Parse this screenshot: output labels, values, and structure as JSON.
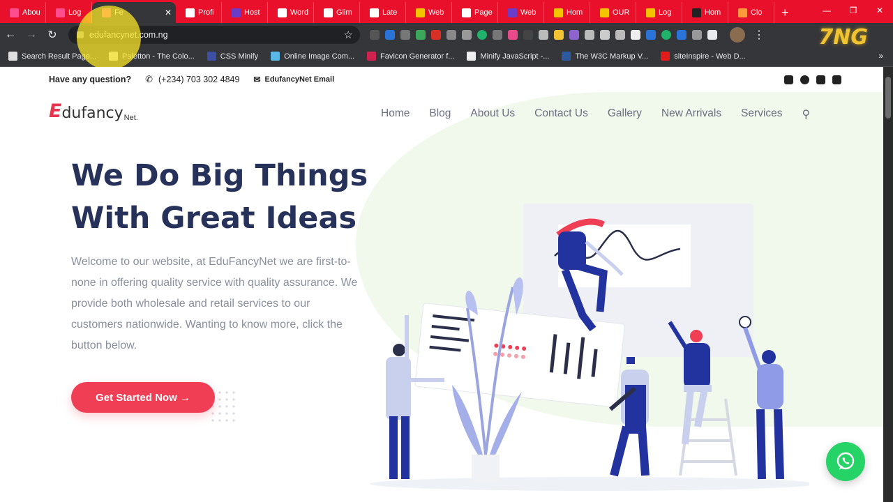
{
  "browser": {
    "tabs": [
      {
        "label": "Abou",
        "color": "#ff4d8d"
      },
      {
        "label": "Log",
        "color": "#ff4d8d"
      },
      {
        "label": "Fe",
        "color": "#ff4d8d",
        "active": true
      },
      {
        "label": "Profi",
        "color": "#ffffff"
      },
      {
        "label": "Host",
        "color": "#6a3cc8"
      },
      {
        "label": "Word",
        "color": "#ffffff"
      },
      {
        "label": "Glim",
        "color": "#ffffff"
      },
      {
        "label": "Late",
        "color": "#ffffff"
      },
      {
        "label": "Web",
        "color": "#f5c400"
      },
      {
        "label": "Page",
        "color": "#ffffff"
      },
      {
        "label": "Web",
        "color": "#6a3cc8"
      },
      {
        "label": "Hom",
        "color": "#f5c400"
      },
      {
        "label": "OUR",
        "color": "#f5c400"
      },
      {
        "label": "Log",
        "color": "#f5c400"
      },
      {
        "label": "Hom",
        "color": "#222222"
      },
      {
        "label": "Clo",
        "color": "#ff9a3c"
      }
    ],
    "url": "edufancynet.com.ng",
    "bookmarks": [
      {
        "label": "Search Result Page...",
        "color": "#e0e0e0"
      },
      {
        "label": "Paletton - The Colo...",
        "color": "#dddddd"
      },
      {
        "label": "CSS Minify",
        "color": "#3d4fa3"
      },
      {
        "label": "Online Image Com...",
        "color": "#5bb7e5"
      },
      {
        "label": "Favicon Generator f...",
        "color": "#d0214f"
      },
      {
        "label": "Minify JavaScript -...",
        "color": "#eeeeee"
      },
      {
        "label": "The W3C Markup V...",
        "color": "#2c5aa0"
      },
      {
        "label": "siteInspire - Web D...",
        "color": "#e21b1b"
      }
    ]
  },
  "site": {
    "topbar": {
      "question": "Have any question?",
      "phone": "(+234) 703 302 4849",
      "email": "EdufancyNet Email"
    },
    "brand": {
      "first": "E",
      "rest": "dufancy",
      "suffix": "Net."
    },
    "menu": [
      "Home",
      "Blog",
      "About Us",
      "Contact Us",
      "Gallery",
      "New Arrivals",
      "Services"
    ],
    "hero": {
      "title_line1": "We Do Big Things",
      "title_line2": "With Great Ideas",
      "text": "Welcome to our website, at EduFancyNet we are first-to-none in offering quality service with quality assurance. We provide both wholesale and retail services to our customers nationwide. Wanting to know more, click the button below.",
      "cta": "Get Started Now →"
    },
    "colors": {
      "accent": "#f03f55",
      "heading": "#27325a",
      "illustration": "#2233a0"
    }
  }
}
